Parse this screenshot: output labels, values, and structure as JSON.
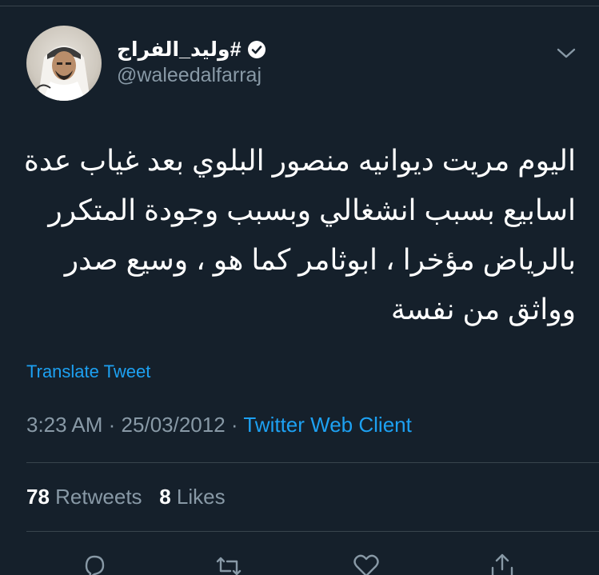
{
  "user": {
    "display_name": "#وليد_الفراج",
    "handle": "@waleedalfarraj",
    "verified": true
  },
  "tweet": {
    "lines": [
      "اليوم مريت ديوانيه منصور البلوي بعد غياب عدة",
      "اسابيع بسبب انشغالي وبسبب وجودة المتكرر",
      "بالرياض مؤخرا ، ابوثامر كما هو ، وسيع صدر",
      "وواثق من نفسة"
    ],
    "translate_label": "Translate Tweet",
    "time": "3:23 AM",
    "date": "25/03/2012",
    "separator": "·",
    "source": "Twitter Web Client"
  },
  "stats": {
    "retweets_count": "78",
    "retweets_label": "Retweets",
    "likes_count": "8",
    "likes_label": "Likes"
  },
  "actions": [
    "reply-icon",
    "retweet-icon",
    "like-icon",
    "share-icon"
  ],
  "colors": {
    "background": "#15202b",
    "text": "#ffffff",
    "secondary": "#8899a6",
    "accent": "#1da1f2",
    "divider": "#38444d"
  }
}
